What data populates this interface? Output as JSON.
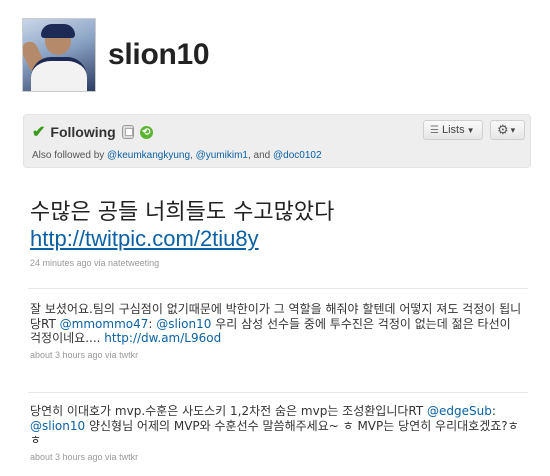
{
  "profile": {
    "username": "slion10"
  },
  "follow": {
    "status_label": "Following",
    "also_prefix": "Also followed by",
    "also_users": [
      "@keumkangkyung",
      "@yumikim1",
      "@doc0102"
    ],
    "sep1": ",",
    "sep2": ", and",
    "lists_label": "Lists",
    "gear_label": "▾"
  },
  "main_tweet": {
    "text": "수많은 공들 너희들도 수고많았다",
    "link": "http://twitpic.com/2tiu8y",
    "meta": "24 minutes ago via natetweeting"
  },
  "tweets": [
    {
      "text_a": "잘 보셨어요.팀의 구심점이 없기때문에 박한이가 그 역할을 해줘야 할텐데 어떻지 져도 걱정이 됩니당RT ",
      "mention1": "@mmommo47",
      "text_b": ": ",
      "mention2": "@slion10",
      "text_c": " 우리 삼성 선수들 중에 투수진은 걱정이 없는데 젊은 타선이 걱정이네요.... ",
      "link": "http://dw.am/L96od",
      "meta": "about 3 hours ago via twtkr"
    },
    {
      "text_a": "당연히 이대호가 mvp.수훈은 사도스키 1,2차전 숨은 mvp는 조성환입니다RT ",
      "mention1": "@edgeSub",
      "text_b": ": ",
      "mention2": "@slion10",
      "text_c": " 양신형님 어제의 MVP와 수훈선수 말씀해주세요~ ㅎ MVP는 당연히 우리대호겠죠?ㅎㅎ",
      "meta": "about 3 hours ago via twtkr"
    }
  ]
}
